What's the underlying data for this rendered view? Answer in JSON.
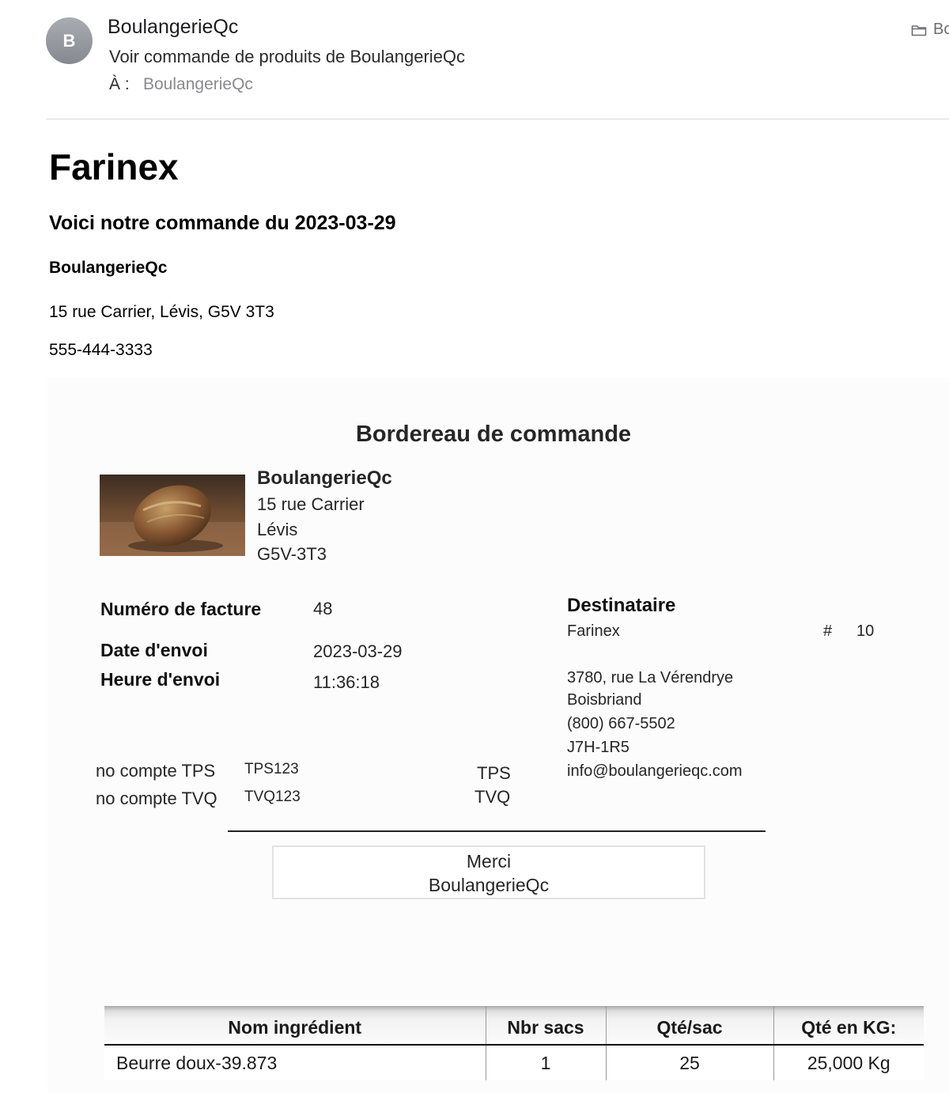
{
  "mail": {
    "avatar_initial": "B",
    "sender": "BoulangerieQc",
    "subject": "Voir commande de produits de BoulangerieQc",
    "to_label": "À :",
    "to_value": "BoulangerieQc",
    "folder_label": "Bo"
  },
  "body": {
    "company": "Farinex",
    "order_heading": "Voici notre commande du 2023-03-29",
    "business_name": "BoulangerieQc",
    "business_address": "15 rue Carrier, Lévis, G5V 3T3",
    "business_phone": "555-444-3333"
  },
  "slip": {
    "title": "Bordereau de commande",
    "business": {
      "name": "BoulangerieQc",
      "street": "15 rue Carrier",
      "city": "Lévis",
      "postal": "G5V-3T3"
    },
    "invoice_label": "Numéro de facture",
    "invoice_value": "48",
    "date_label": "Date d'envoi",
    "date_value": "2023-03-29",
    "time_label": "Heure d'envoi",
    "time_value": "11:36:18",
    "tps_account_label": "no compte TPS",
    "tps_account_value": "TPS123",
    "tvq_account_label": "no compte TVQ",
    "tvq_account_value": "TVQ123",
    "tps_label": "TPS",
    "tvq_label": "TVQ",
    "recipient": {
      "title": "Destinataire",
      "name": "Farinex",
      "number_sign": "#",
      "number": "10",
      "street": "3780, rue La Vérendrye",
      "city": "Boisbriand",
      "phone": "(800) 667-5502",
      "postal": "J7H-1R5",
      "email": "info@boulangerieqc.com"
    },
    "thanks_line1": "Merci",
    "thanks_line2": "BoulangerieQc"
  },
  "table": {
    "headers": [
      "Nom ingrédient",
      "Nbr sacs",
      "Qté/sac",
      "Qté en KG:"
    ],
    "rows": [
      [
        "Beurre doux-39.873",
        "1",
        "25",
        "25,000 Kg"
      ]
    ]
  }
}
